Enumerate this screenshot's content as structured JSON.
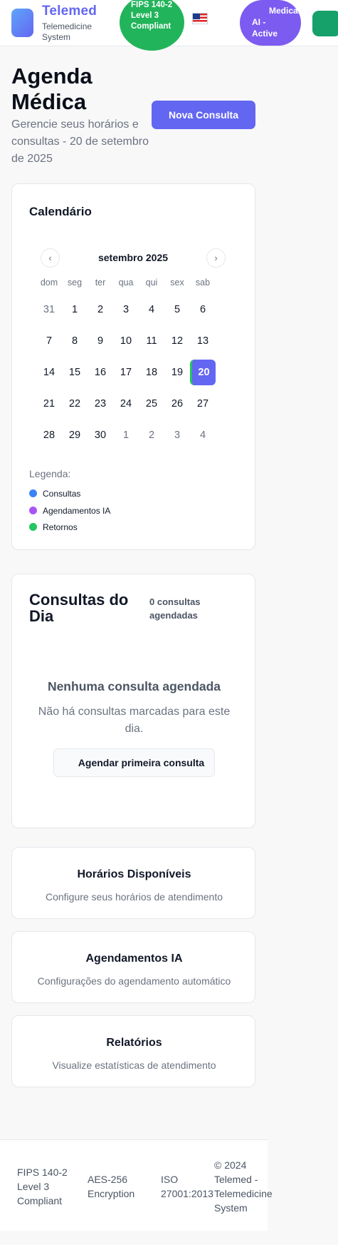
{
  "header": {
    "brand_title": "Telemed",
    "brand_subtitle": "Telemedicine System",
    "fips_badge": "FIPS 140-2 Level 3 Compliant",
    "language_flag": "us-flag-icon",
    "ai_badge_line1": "Medical",
    "ai_badge_line2": "AI - Active"
  },
  "page": {
    "title": "Agenda Médica",
    "subtitle": "Gerencie seus horários e consultas - 20 de setembro de 2025",
    "new_button": "Nova Consulta",
    "new_button_icon": "plus-icon"
  },
  "calendar": {
    "title": "Calendário",
    "month": "setembro 2025",
    "prev_icon": "chevron-left-icon",
    "next_icon": "chevron-right-icon",
    "weekdays": [
      "dom",
      "seg",
      "ter",
      "qua",
      "qui",
      "sex",
      "sab"
    ],
    "weeks": [
      [
        "31",
        "1",
        "2",
        "3",
        "4",
        "5",
        "6"
      ],
      [
        "7",
        "8",
        "9",
        "10",
        "11",
        "12",
        "13"
      ],
      [
        "14",
        "15",
        "16",
        "17",
        "18",
        "19",
        "20"
      ],
      [
        "21",
        "22",
        "23",
        "24",
        "25",
        "26",
        "27"
      ],
      [
        "28",
        "29",
        "30",
        "1",
        "2",
        "3",
        "4"
      ]
    ],
    "selected_day": "20",
    "legend_title": "Legenda:",
    "legend": [
      {
        "label": "Consultas",
        "color": "#3b82f6"
      },
      {
        "label": "Agendamentos IA",
        "color": "#a855f7"
      },
      {
        "label": "Retornos",
        "color": "#22c55e"
      }
    ]
  },
  "day_panel": {
    "title": "Consultas do Dia",
    "count": "0 consultas agendadas",
    "empty_title": "Nenhuma consulta agendada",
    "empty_text": "Não há consultas marcadas para este dia.",
    "first_button": "Agendar primeira consulta"
  },
  "links": [
    {
      "title": "Horários Disponíveis",
      "subtitle": "Configure seus horários de atendimento"
    },
    {
      "title": "Agendamentos IA",
      "subtitle": "Configurações do agendamento automático"
    },
    {
      "title": "Relatórios",
      "subtitle": "Visualize estatísticas de atendimento"
    }
  ],
  "footer": {
    "fips": "FIPS 140-2 Level 3 Compliant",
    "aes": "AES-256 Encryption",
    "iso": "ISO 27001:2013",
    "copyright": "© 2024 Telemed - Telemedicine System"
  },
  "colors": {
    "primary": "#6366f1",
    "fips_green": "#22b45a",
    "ai_purple": "#7c5cf0",
    "today_marker": "#22c55e"
  }
}
